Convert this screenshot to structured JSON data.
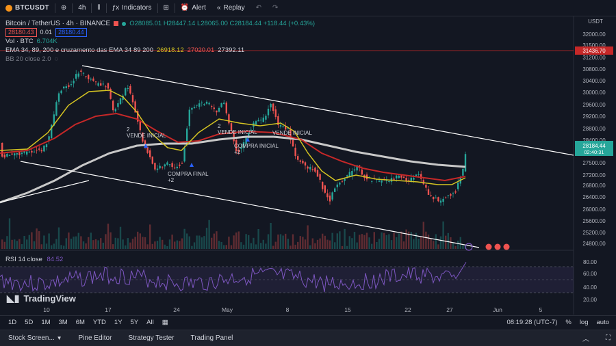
{
  "toolbar": {
    "symbol": "BTCUSDT",
    "interval": "4h",
    "indicators_label": "Indicators",
    "alert_label": "Alert",
    "replay_label": "Replay"
  },
  "legend": {
    "title": "Bitcoin / TetherUS · 4h · BINANCE",
    "ohlc": "O28085.01 H28447.14 L28065.00 C28184.44 +118.44 (+0.43%)",
    "bid": "28180.43",
    "spread": "0.01",
    "ask": "28180.44",
    "volume_label": "Vol · BTC",
    "volume_value": "6.704K",
    "ema_label": "EMA 34, 89, 200 e cruzamento das EMA 34 89 200",
    "ema34": "26918.12",
    "ema89": "27020.01",
    "ema200": "27392.11",
    "bb_label": "BB 20 close 2.0"
  },
  "price_axis": {
    "currency": "USDT",
    "ticks": [
      "32000.00",
      "31500.00",
      "31200.00",
      "30800.00",
      "30400.00",
      "30000.00",
      "29600.00",
      "29200.00",
      "28800.00",
      "28400.00",
      "27800.00",
      "27500.00",
      "27200.00",
      "26800.00",
      "26400.00",
      "26000.00",
      "25600.00",
      "25200.00",
      "24800.00"
    ],
    "last_price": "28184.44",
    "countdown": "02:40:31",
    "hline_price": "31436.70"
  },
  "annotations": [
    {
      "id": "sell1",
      "text": "2\nVENDE INICIAL"
    },
    {
      "id": "buy1",
      "text": "COMPRA FINAL\n+2"
    },
    {
      "id": "sell2",
      "text": "2\nVENDE INICIAL"
    },
    {
      "id": "buy2",
      "text": "COMPRA INICIAL\n+2"
    },
    {
      "id": "sell3",
      "text": "VENDE INICIAL"
    }
  ],
  "rsi": {
    "label": "RSI 14 close",
    "value": "84.52",
    "ticks": [
      "80.00",
      "60.00",
      "40.00",
      "20.00"
    ]
  },
  "time_axis": {
    "ticks": [
      "10",
      "17",
      "24",
      "May",
      "8",
      "15",
      "22",
      "27",
      "Jun",
      "5"
    ]
  },
  "brand": "TradingView",
  "timeframes": [
    "1D",
    "5D",
    "1M",
    "3M",
    "6M",
    "YTD",
    "1Y",
    "5Y",
    "All"
  ],
  "clock": "08:19:28 (UTC-7)",
  "scale_opts": [
    "%",
    "log",
    "auto"
  ],
  "bottom_tabs": [
    "Stock Screen...",
    "Pine Editor",
    "Strategy Tester",
    "Trading Panel"
  ],
  "colors": {
    "bg": "#131722",
    "up": "#26a69a",
    "down": "#ef5350",
    "ema34": "#d4c322",
    "ema89": "#c62828",
    "ema200": "#c8c8c8",
    "rsi": "#7e57c2"
  }
}
